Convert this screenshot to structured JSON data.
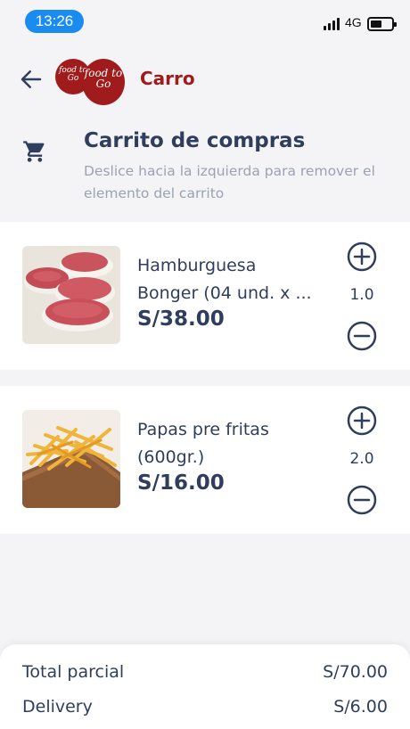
{
  "status_bar": {
    "time": "13:26",
    "network": "4G",
    "battery_level": 0.4
  },
  "header": {
    "back_icon": "arrow-left-icon",
    "logo_text_small": "food to Go",
    "logo_text_large": "food to Go",
    "title": "Carro"
  },
  "cart": {
    "icon": "shopping-cart-icon",
    "title": "Carrito de compras",
    "subtitle": "Deslice hacia la izquierda para remover el elemento del carrito"
  },
  "items": [
    {
      "name_line1": "Hamburguesa",
      "name_line2": "Bonger (04 und. x ...",
      "price": "S/38.00",
      "quantity": "1.0",
      "image": "burger-patties-photo"
    },
    {
      "name_line1": "Papas pre fritas",
      "name_line2": "(600gr.)",
      "price": "S/16.00",
      "quantity": "2.0",
      "image": "french-fries-photo"
    }
  ],
  "summary": {
    "subtotal_label": "Total parcial",
    "subtotal_value": "S/70.00",
    "delivery_label": "Delivery",
    "delivery_value": "S/6.00"
  },
  "colors": {
    "accent_blue": "#1a8cf0",
    "brand_red": "#9e1c1c",
    "text_dark": "#2f3e5c",
    "text_muted": "#9aa3b2",
    "background": "#f4f4f6"
  }
}
